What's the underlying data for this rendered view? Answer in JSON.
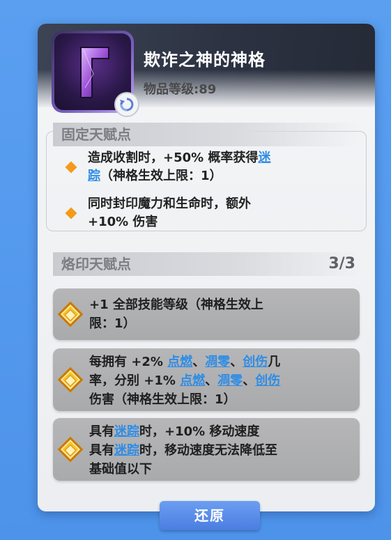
{
  "item": {
    "title": "欺诈之神的神格",
    "level_label": "物品等级:89"
  },
  "fixed_section": {
    "title": "固定天赋点",
    "items": [
      {
        "parts": [
          {
            "text": "造成收割时，+50% 概率获得",
            "link": false
          },
          {
            "text": "迷",
            "link": true
          },
          {
            "text": "踪",
            "link": true
          },
          {
            "text": "（神格生效上限：1）",
            "link": false
          }
        ]
      },
      {
        "line1": "同时封印魔力和生命时，额外",
        "line2": "+10% 伤害"
      }
    ]
  },
  "rune_section": {
    "title": "烙印天赋点",
    "count": "3/3",
    "runes": [
      {
        "line1": "+1 全部技能等级（神格生效上",
        "line2": "限：1）"
      },
      {
        "l1a": "每拥有 +2% ",
        "l1b": "点燃",
        "l1c": "、",
        "l1d": "凋零",
        "l1e": "、",
        "l1f": "创伤",
        "l1g": "几",
        "l2a": "率，分别 +1% ",
        "l2b": "点燃",
        "l2c": "、",
        "l2d": "凋零",
        "l2e": "、",
        "l2f": "创伤",
        "line3": "伤害（神格生效上限：1）"
      },
      {
        "l1a": "具有",
        "l1b": "迷踪",
        "l1c": "时，+10% 移动速度",
        "l2a": "具有",
        "l2b": "迷踪",
        "l2c": "时，移动速度无法降低至",
        "line3": "基础值以下"
      }
    ]
  },
  "buttons": {
    "restore": "还原"
  },
  "icons": {
    "item_icon": "purple-crystal-item-icon",
    "badge": "refresh-icon",
    "bullet": "orange-diamond-bullet-icon",
    "rune": "gold-diamond-rune-icon"
  },
  "colors": {
    "link": "#2e8de6",
    "bullet": "#f59a1b",
    "button": "#4a7de0"
  }
}
